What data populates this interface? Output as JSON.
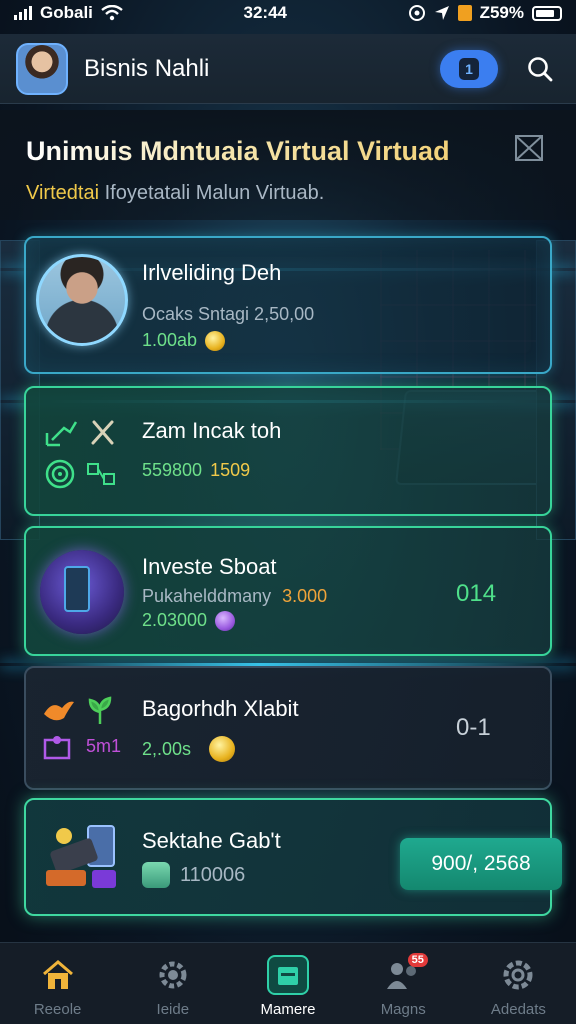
{
  "status_bar": {
    "carrier": "Gobali",
    "time": "32:44",
    "battery": "Z59%"
  },
  "header": {
    "profile_name": "Bisnis Nahli",
    "action_icon": "number-badge-icon",
    "action_label": "1",
    "search_icon": "search-icon"
  },
  "hero": {
    "title": "Unimuis Mdntuaia Virtual Virtuad",
    "subtitle_accent": "Virtedtai",
    "subtitle_rest": "Ifoyetatali Malun Virtuab."
  },
  "cards": [
    {
      "title": "Irlveliding Deh",
      "subtitle": "Ocaks Sntagi 2,50,00",
      "value": "1.00ab",
      "icon": "avatar-photo"
    },
    {
      "title": "Zam Incak toh",
      "value_a": "559800",
      "value_b": "1509",
      "icon": "growth-tools-icon"
    },
    {
      "title": "Investe Sboat",
      "subtitle": "Pukahelddmany",
      "subtitle_value": "3.000",
      "value": "2.03000",
      "right_value": "014",
      "icon": "phone-investor-icon"
    },
    {
      "title": "Bagorhdh Xlabit",
      "value_a": "5m1",
      "value_b": "2,.00s",
      "right_value": "0-1",
      "icon": "leaf-bird-icon"
    },
    {
      "title": "Sektahe Gab't",
      "value": "110006",
      "button_label": "900/, 2568",
      "icon": "gadget-bundle-icon"
    }
  ],
  "bottom_nav": [
    {
      "label": "Reeole",
      "icon": "home-icon",
      "active": false
    },
    {
      "label": "Ieide",
      "icon": "gear-icon",
      "active": false
    },
    {
      "label": "Mamere",
      "icon": "calendar-icon",
      "active": true
    },
    {
      "label": "Magns",
      "icon": "community-icon",
      "active": false,
      "badge": "55"
    },
    {
      "label": "Adedats",
      "icon": "settings-cog-icon",
      "active": false
    }
  ],
  "colors": {
    "accent_blue": "#3b7ef0",
    "card_border": "#3aa8c8",
    "card_green": "#38d49a",
    "gold": "#f0c94a",
    "value_green": "#6ee08a"
  }
}
